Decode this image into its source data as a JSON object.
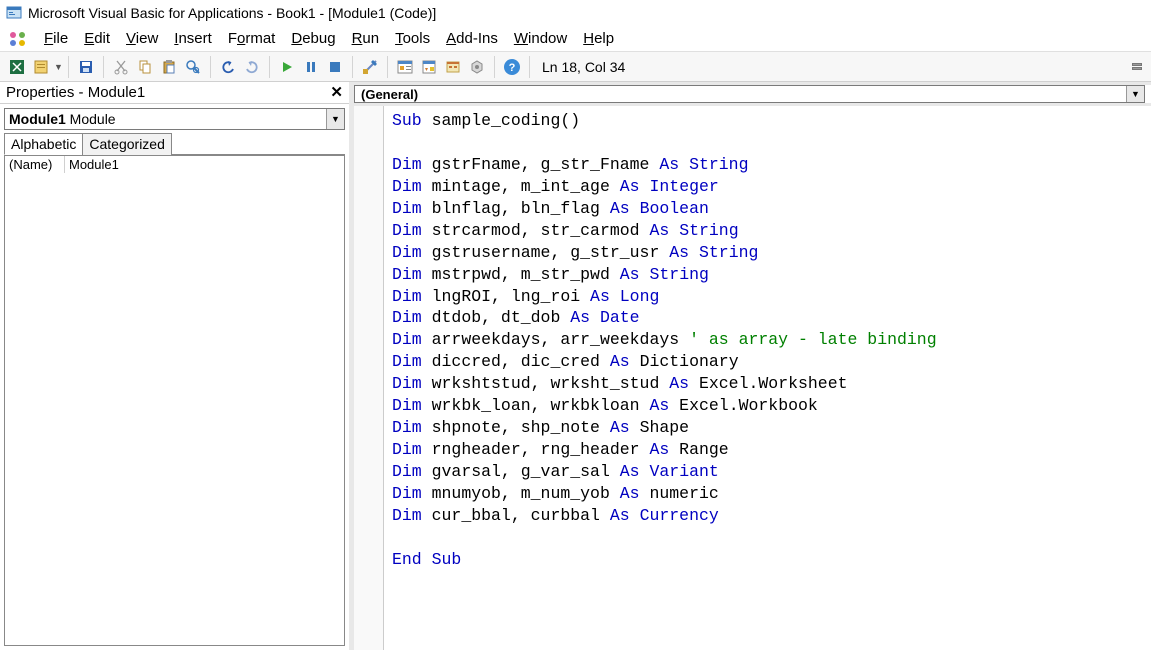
{
  "titlebar": {
    "text": "Microsoft Visual Basic for Applications - Book1 - [Module1 (Code)]"
  },
  "menubar": {
    "items": [
      {
        "label": "File",
        "u": "F"
      },
      {
        "label": "Edit",
        "u": "E"
      },
      {
        "label": "View",
        "u": "V"
      },
      {
        "label": "Insert",
        "u": "I"
      },
      {
        "label": "Format",
        "u": "o"
      },
      {
        "label": "Debug",
        "u": "D"
      },
      {
        "label": "Run",
        "u": "R"
      },
      {
        "label": "Tools",
        "u": "T"
      },
      {
        "label": "Add-Ins",
        "u": "A"
      },
      {
        "label": "Window",
        "u": "W"
      },
      {
        "label": "Help",
        "u": "H"
      }
    ]
  },
  "toolbar": {
    "status": "Ln 18, Col 34"
  },
  "properties": {
    "title": "Properties - Module1",
    "combo_bold": "Module1",
    "combo_rest": " Module",
    "tabs": [
      "Alphabetic",
      "Categorized"
    ],
    "row_name": "(Name)",
    "row_value": "Module1"
  },
  "codecombo": {
    "left": "(General)"
  },
  "code": {
    "lines": [
      {
        "t": "sub",
        "text": "Sub sample_coding()"
      },
      {
        "t": "blank"
      },
      {
        "t": "dim",
        "vars": "gstrFname, g_str_Fname",
        "as": true,
        "type": "String"
      },
      {
        "t": "dim",
        "vars": "mintage, m_int_age",
        "as": true,
        "type": "Integer"
      },
      {
        "t": "dim",
        "vars": "blnflag, bln_flag",
        "as": true,
        "type": "Boolean"
      },
      {
        "t": "dim",
        "vars": "strcarmod, str_carmod",
        "as": true,
        "type": "String"
      },
      {
        "t": "dim",
        "vars": "gstrusername, g_str_usr",
        "as": true,
        "type": "String"
      },
      {
        "t": "dim",
        "vars": "mstrpwd, m_str_pwd",
        "as": true,
        "type": "String"
      },
      {
        "t": "dim",
        "vars": "lngROI, lng_roi",
        "as": true,
        "type": "Long"
      },
      {
        "t": "dim",
        "vars": "dtdob, dt_dob",
        "as": true,
        "type": "Date"
      },
      {
        "t": "dimcomment",
        "vars": "arrweekdays, arr_weekdays",
        "comment": "' as array - late binding"
      },
      {
        "t": "dim",
        "vars": "diccred, dic_cred",
        "as": true,
        "type": "Dictionary",
        "plain": true
      },
      {
        "t": "dim",
        "vars": "wrkshtstud, wrksht_stud",
        "as": true,
        "type": "Excel.Worksheet",
        "plain": true
      },
      {
        "t": "dim",
        "vars": "wrkbk_loan, wrkbkloan",
        "as": true,
        "type": "Excel.Workbook",
        "plain": true
      },
      {
        "t": "dim",
        "vars": "shpnote, shp_note",
        "as": true,
        "type": "Shape",
        "plain": true
      },
      {
        "t": "dim",
        "vars": "rngheader, rng_header",
        "as": true,
        "type": "Range",
        "plain": true
      },
      {
        "t": "dim",
        "vars": "gvarsal, g_var_sal",
        "as": true,
        "type": "Variant"
      },
      {
        "t": "dim",
        "vars": "mnumyob, m_num_yob",
        "as": true,
        "type": "numeric",
        "plain": true
      },
      {
        "t": "dim",
        "vars": "cur_bbal, curbbal",
        "as": true,
        "type": "Currency"
      },
      {
        "t": "blank"
      },
      {
        "t": "endsub",
        "text": "End Sub"
      }
    ]
  }
}
